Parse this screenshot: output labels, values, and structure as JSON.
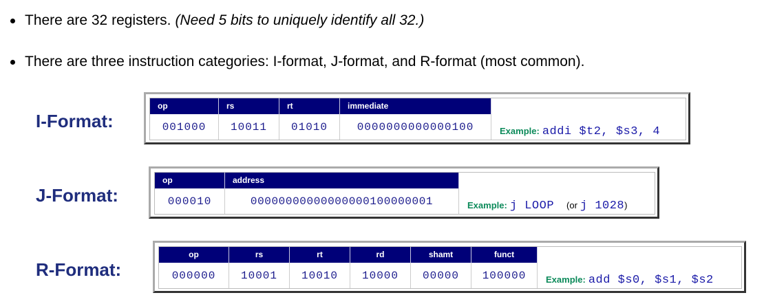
{
  "bullets": [
    {
      "text": "There are 32 registers.",
      "note": "(Need 5 bits to uniquely identify all 32.)"
    },
    {
      "text": "There are three instruction categories: I-format, J-format, and R-format (most common).",
      "note": ""
    }
  ],
  "formats": {
    "i": {
      "label": "I-Format:",
      "fields": [
        {
          "name": "op",
          "value": "001000"
        },
        {
          "name": "rs",
          "value": "10011"
        },
        {
          "name": "rt",
          "value": "01010"
        },
        {
          "name": "immediate",
          "value": "0000000000000100"
        }
      ],
      "example_label": "Example:",
      "example_code": "addi $t2, $s3, 4"
    },
    "j": {
      "label": "J-Format:",
      "fields": [
        {
          "name": "op",
          "value": "000010"
        },
        {
          "name": "address",
          "value": "00000000000000000100000001"
        }
      ],
      "example_label": "Example:",
      "example_code": "j LOOP",
      "alt_open": "(or",
      "alt_code": "j 1028",
      "alt_close": ")"
    },
    "r": {
      "label": "R-Format:",
      "fields": [
        {
          "name": "op",
          "value": "000000"
        },
        {
          "name": "rs",
          "value": "10001"
        },
        {
          "name": "rt",
          "value": "10010"
        },
        {
          "name": "rd",
          "value": "10000"
        },
        {
          "name": "shamt",
          "value": "00000"
        },
        {
          "name": "funct",
          "value": "100000"
        }
      ],
      "example_label": "Example:",
      "example_code": "add $s0, $s1, $s2"
    }
  }
}
